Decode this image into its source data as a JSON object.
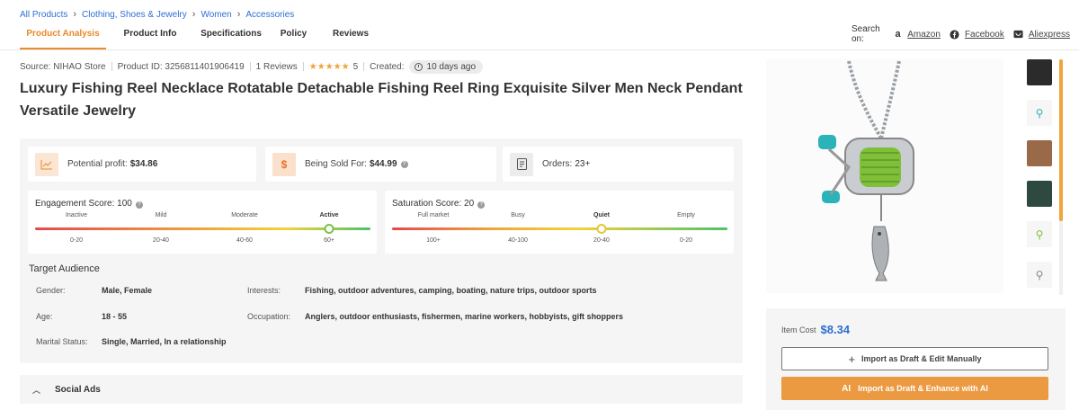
{
  "breadcrumb": [
    "All Products",
    "Clothing, Shoes & Jewelry",
    "Women",
    "Accessories"
  ],
  "tabs": [
    "Product Analysis",
    "Product Info",
    "Specifications",
    "Policy",
    "Reviews"
  ],
  "search_on": {
    "label": "Search on:",
    "links": [
      "Amazon",
      "Facebook",
      "Aliexpress"
    ]
  },
  "meta": {
    "source": "Source: NIHAO Store",
    "product_id": "Product ID: 3256811401906419",
    "reviews": "1 Reviews",
    "stars": "★★★★★",
    "rating": "5",
    "created_label": "Created:",
    "created_value": "10 days ago"
  },
  "title": "Luxury Fishing Reel Necklace Rotatable Detachable Fishing Reel Ring Exquisite Silver Men Neck Pendant Versatile Jewelry",
  "stats": {
    "profit_label": "Potential profit:",
    "profit_value": "$34.86",
    "sold_label": "Being Sold For:",
    "sold_value": "$44.99",
    "orders_label": "Orders:",
    "orders_value": "23+"
  },
  "engagement": {
    "title": "Engagement Score: 100",
    "levels": [
      "Inactive",
      "Mild",
      "Moderate",
      "Active"
    ],
    "ranges": [
      "0-20",
      "20-40",
      "40-60",
      "60+"
    ],
    "active_index": 3
  },
  "saturation": {
    "title": "Saturation Score: 20",
    "levels": [
      "Full market",
      "Busy",
      "Quiet",
      "Empty"
    ],
    "ranges": [
      "100+",
      "40-100",
      "20-40",
      "0-20"
    ],
    "active_index": 2
  },
  "audience": {
    "title": "Target Audience",
    "gender_label": "Gender:",
    "gender": "Male, Female",
    "age_label": "Age:",
    "age": "18 - 55",
    "marital_label": "Marital Status:",
    "marital": "Single, Married, In a relationship",
    "interests_label": "Interests:",
    "interests": "Fishing, outdoor adventures, camping, boating, nature trips, outdoor sports",
    "occupation_label": "Occupation:",
    "occupation": "Anglers, outdoor enthusiasts, fishermen, marine workers, hobbyists, gift shoppers"
  },
  "social_ads": "Social Ads",
  "purchase": {
    "item_cost_label": "Item Cost",
    "item_cost": "$8.34",
    "draft_button": "Import as Draft & Edit Manually",
    "ai_button": "Import as Draft & Enhance with AI",
    "ai_badge": "AI"
  },
  "colors": {
    "accent": "#e98a2c",
    "link": "#2f6fd3",
    "ai_button": "#eb9a42",
    "panel_bg": "#f5f5f5"
  }
}
